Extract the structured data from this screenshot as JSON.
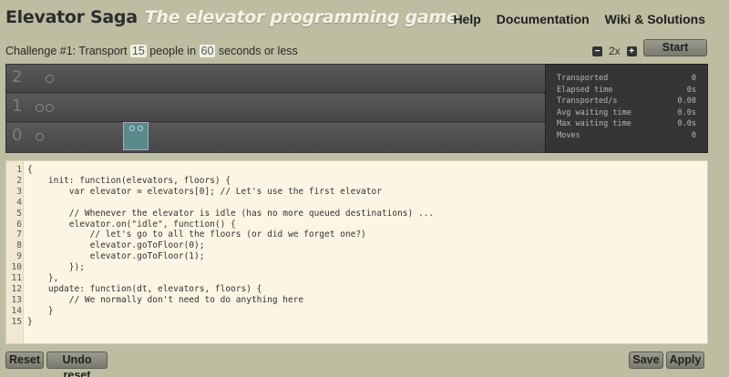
{
  "header": {
    "title": "Elevator Saga",
    "subtitle": "The elevator programming game"
  },
  "nav": {
    "help": "Help",
    "documentation": "Documentation",
    "wiki": "Wiki & Solutions"
  },
  "challenge": {
    "prefix": "Challenge #1: Transport",
    "people": "15",
    "middle": "people in",
    "seconds": "60",
    "suffix": "seconds or less"
  },
  "speed": {
    "minus": "−",
    "factor": "2x",
    "plus": "+"
  },
  "buttons": {
    "start": "Start",
    "reset": "Reset",
    "undo_reset": "Undo reset",
    "save": "Save",
    "apply": "Apply"
  },
  "world": {
    "floors": [
      "2",
      "1",
      "0"
    ]
  },
  "stats": [
    {
      "label": "Transported",
      "value": "0"
    },
    {
      "label": "Elapsed time",
      "value": "0s"
    },
    {
      "label": "Transported/s",
      "value": "0.00"
    },
    {
      "label": "Avg waiting time",
      "value": "0.0s"
    },
    {
      "label": "Max waiting time",
      "value": "0.0s"
    },
    {
      "label": "Moves",
      "value": "0"
    }
  ],
  "code_lines": [
    "{",
    "    init: function(elevators, floors) {",
    "        var elevator = elevators[0]; // Let's use the first elevator",
    "",
    "        // Whenever the elevator is idle (has no more queued destinations) ...",
    "        elevator.on(\"idle\", function() {",
    "            // let's go to all the floors (or did we forget one?)",
    "            elevator.goToFloor(0);",
    "            elevator.goToFloor(1);",
    "        });",
    "    },",
    "    update: function(dt, elevators, floors) {",
    "        // We normally don't need to do anything here",
    "    }",
    "}"
  ],
  "line_numbers": [
    "1",
    "2",
    "3",
    "4",
    "5",
    "6",
    "7",
    "8",
    "9",
    "10",
    "11",
    "12",
    "13",
    "14",
    "15"
  ]
}
